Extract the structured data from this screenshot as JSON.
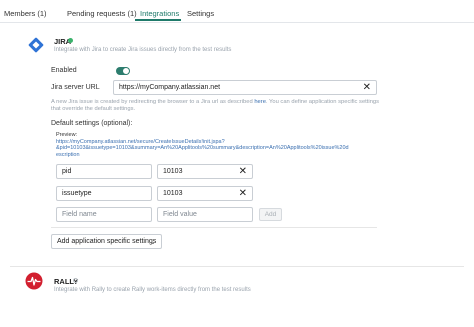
{
  "tabs": [
    {
      "label": "Members (1)"
    },
    {
      "label": "Pending requests (1)"
    },
    {
      "label": "Integrations"
    },
    {
      "label": "Settings"
    }
  ],
  "jira": {
    "name": "JIRA",
    "status_color": "#3ab26b",
    "description": "Integrate with Jira to create Jira issues directly from the test results",
    "enabled_label": "Enabled",
    "enabled": true,
    "server_url_label": "Jira server URL",
    "server_url_value": "https://myCompany.atlassian.net",
    "note_part1": "A new Jira issue is created by redirecting the browser to a Jira url as described ",
    "note_link": "here",
    "note_part2": ". You can define application specific settings",
    "note_line2": "that override the default settings.",
    "default_settings_label": "Default settings (optional):",
    "preview_label": "Preview:",
    "preview_lines": [
      "https://myCompany.atlassian.net/secure/CreateIssueDetails!init.jspa?",
      "&pid=10103&issuetype=10103&summary=An%20Applitools%20summary&description=An%20Applitools%20issue%20d",
      "escription"
    ],
    "fields": [
      {
        "name": "pid",
        "value": "10103"
      },
      {
        "name": "issuetype",
        "value": "10103"
      }
    ],
    "field_name_placeholder": "Field name",
    "field_value_placeholder": "Field value",
    "add_label": "Add",
    "app_settings_label": "Add application specific settings"
  },
  "rally": {
    "name": "RALLY",
    "description": "Integrate with Rally to create Rally work-items directly from the test results"
  }
}
